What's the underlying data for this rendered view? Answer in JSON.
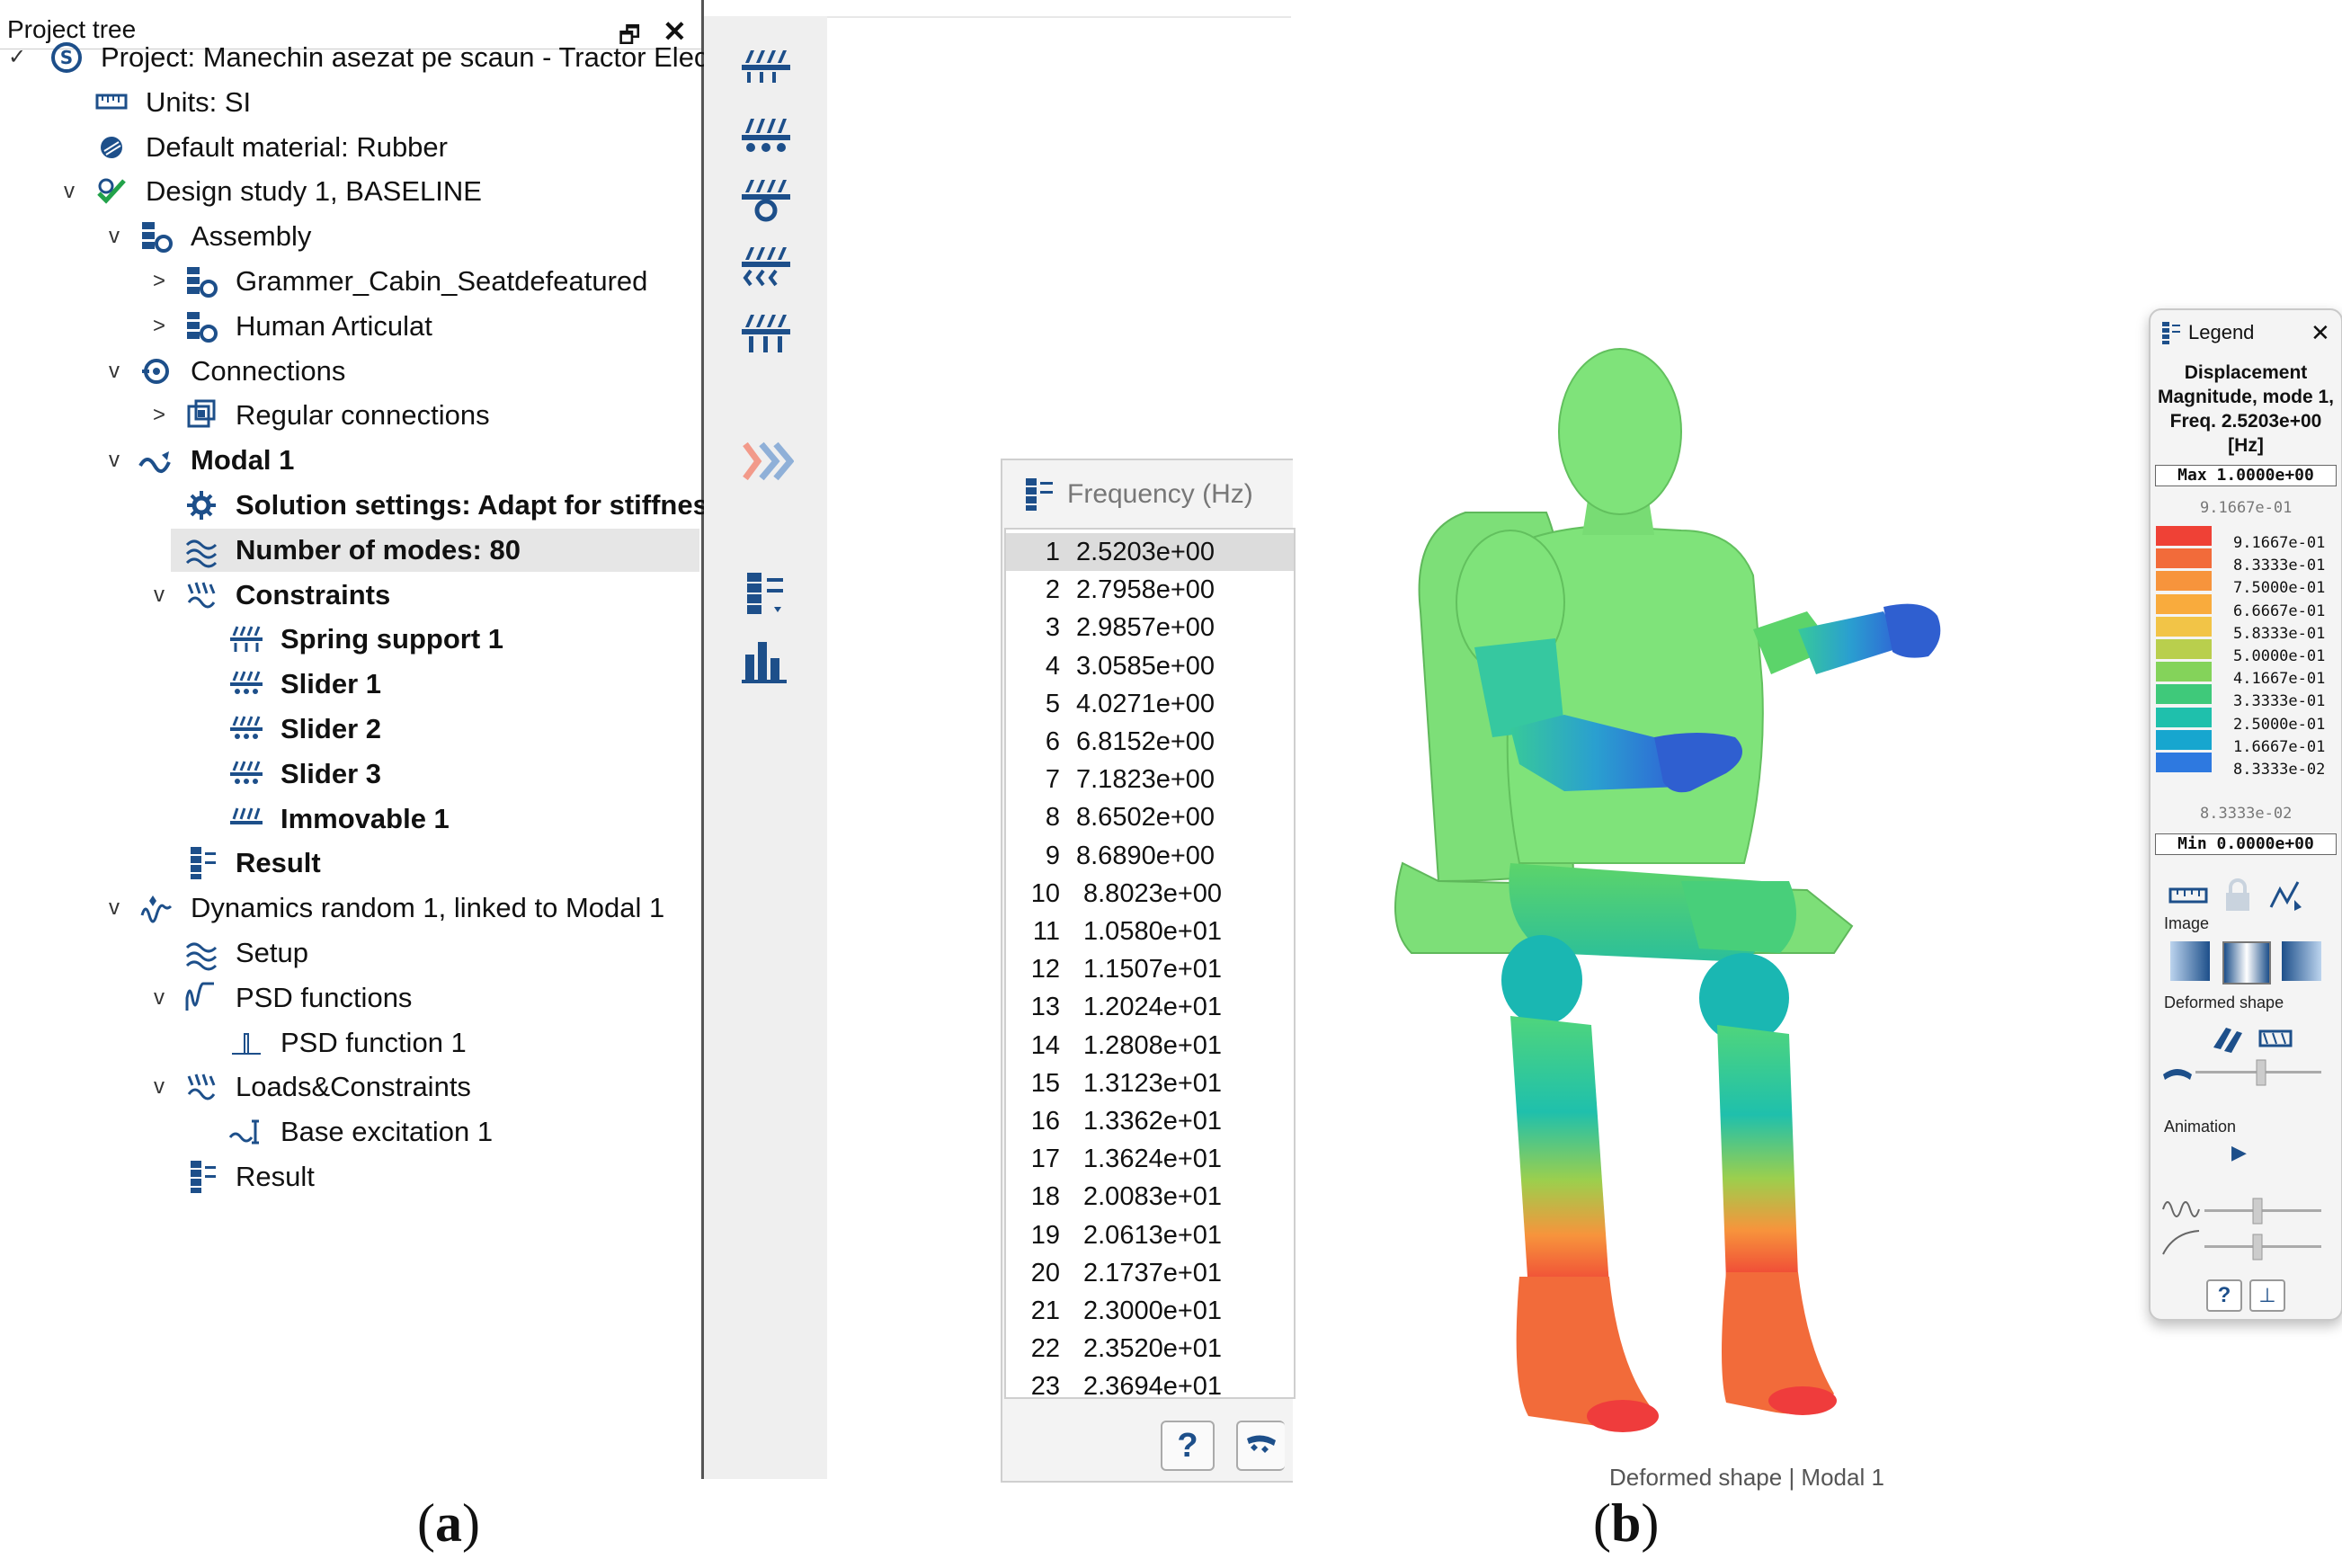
{
  "tree": {
    "title": "Project tree",
    "restore_glyph": "🗗",
    "close_glyph": "✕",
    "items": [
      {
        "label": "Project: Manechin asezat pe scaun - Tractor Elec...",
        "icon": "project-icon",
        "level": 0,
        "chev": "✓"
      },
      {
        "label": "Units: SI",
        "icon": "units-icon",
        "level": 1,
        "chev": ""
      },
      {
        "label": "Default material: Rubber",
        "icon": "material-icon",
        "level": 1,
        "chev": ""
      },
      {
        "label": "Design study 1, BASELINE",
        "icon": "design-study-icon",
        "level": 1,
        "chev": "v"
      },
      {
        "label": "Assembly",
        "icon": "assembly-icon",
        "level": 2,
        "chev": "v"
      },
      {
        "label": "Grammer_Cabin_Seatdefeatured",
        "icon": "assembly-icon",
        "level": 3,
        "chev": ">"
      },
      {
        "label": "Human Articulat",
        "icon": "assembly-icon",
        "level": 3,
        "chev": ">"
      },
      {
        "label": "Connections",
        "icon": "connections-icon",
        "level": 2,
        "chev": "v"
      },
      {
        "label": "Regular connections",
        "icon": "regular-connections-icon",
        "level": 3,
        "chev": ">"
      },
      {
        "label": "Modal 1",
        "icon": "modal-icon",
        "level": 2,
        "chev": "v",
        "bold": true
      },
      {
        "label": "Solution settings: Adapt for stiffness",
        "icon": "gear-icon",
        "level": 3,
        "chev": "",
        "bold": true
      },
      {
        "label": "Number of modes: 80",
        "icon": "modes-icon",
        "level": 3,
        "chev": "",
        "bold": true,
        "selected": true
      },
      {
        "label": "Constraints",
        "icon": "constraints-icon",
        "level": 3,
        "chev": "v",
        "bold": true
      },
      {
        "label": "Spring support 1",
        "icon": "spring-support-icon",
        "level": 4,
        "chev": "",
        "bold": true
      },
      {
        "label": "Slider 1",
        "icon": "slider-icon",
        "level": 4,
        "chev": "",
        "bold": true
      },
      {
        "label": "Slider 2",
        "icon": "slider-icon",
        "level": 4,
        "chev": "",
        "bold": true
      },
      {
        "label": "Slider 3",
        "icon": "slider-icon",
        "level": 4,
        "chev": "",
        "bold": true
      },
      {
        "label": "Immovable 1",
        "icon": "immovable-icon",
        "level": 4,
        "chev": "",
        "bold": true
      },
      {
        "label": "Result",
        "icon": "result-icon",
        "level": 3,
        "chev": "",
        "bold": true
      },
      {
        "label": "Dynamics random 1, linked to Modal 1",
        "icon": "dynamics-random-icon",
        "level": 2,
        "chev": "v"
      },
      {
        "label": "Setup",
        "icon": "modes-icon",
        "level": 3,
        "chev": ""
      },
      {
        "label": "PSD functions",
        "icon": "psd-functions-icon",
        "level": 3,
        "chev": "v"
      },
      {
        "label": "PSD function  1",
        "icon": "psd-function-icon",
        "level": 4,
        "chev": ""
      },
      {
        "label": "Loads&Constraints",
        "icon": "constraints-icon",
        "level": 3,
        "chev": "v"
      },
      {
        "label": "Base excitation 1",
        "icon": "base-excitation-icon",
        "level": 4,
        "chev": ""
      },
      {
        "label": "Result",
        "icon": "result-icon",
        "level": 3,
        "chev": ""
      }
    ]
  },
  "freq": {
    "header": "Frequency (Hz)",
    "rows": [
      {
        "n": "1",
        "v": "2.5203e+00"
      },
      {
        "n": "2",
        "v": "2.7958e+00"
      },
      {
        "n": "3",
        "v": "2.9857e+00"
      },
      {
        "n": "4",
        "v": "3.0585e+00"
      },
      {
        "n": "5",
        "v": "4.0271e+00"
      },
      {
        "n": "6",
        "v": "6.8152e+00"
      },
      {
        "n": "7",
        "v": "7.1823e+00"
      },
      {
        "n": "8",
        "v": "8.6502e+00"
      },
      {
        "n": "9",
        "v": "8.6890e+00"
      },
      {
        "n": "10",
        "v": "8.8023e+00"
      },
      {
        "n": "11",
        "v": "1.0580e+01"
      },
      {
        "n": "12",
        "v": "1.1507e+01"
      },
      {
        "n": "13",
        "v": "1.2024e+01"
      },
      {
        "n": "14",
        "v": "1.2808e+01"
      },
      {
        "n": "15",
        "v": "1.3123e+01"
      },
      {
        "n": "16",
        "v": "1.3362e+01"
      },
      {
        "n": "17",
        "v": "1.3624e+01"
      },
      {
        "n": "18",
        "v": "2.0083e+01"
      },
      {
        "n": "19",
        "v": "2.0613e+01"
      },
      {
        "n": "20",
        "v": "2.1737e+01"
      },
      {
        "n": "21",
        "v": "2.3000e+01"
      },
      {
        "n": "22",
        "v": "2.3520e+01"
      },
      {
        "n": "23",
        "v": "2.3694e+01"
      }
    ],
    "help_label": "?"
  },
  "labels": {
    "a": "a",
    "b": "b",
    "open": "(",
    "close": ")"
  },
  "legend": {
    "header": "Legend",
    "close_glyph": "✕",
    "title": "Displacement Magnitude, mode 1, Freq. 2.5203e+00 [Hz]",
    "max": "Max 1.0000e+00",
    "top_small": "9.1667e-01",
    "values": [
      "9.1667e-01",
      "8.3333e-01",
      "7.5000e-01",
      "6.6667e-01",
      "5.8333e-01",
      "5.0000e-01",
      "4.1667e-01",
      "3.3333e-01",
      "2.5000e-01",
      "1.6667e-01",
      "8.3333e-02"
    ],
    "colors": [
      "#ef4136",
      "#f26b3a",
      "#f7943c",
      "#f9ab3d",
      "#f2c447",
      "#b9cf4d",
      "#84d35a",
      "#3fc97a",
      "#1fc0ac",
      "#17a6cf",
      "#2e79e0"
    ],
    "bottom_small": "8.3333e-02",
    "min": "Min 0.0000e+00",
    "image_label": "Image",
    "deformed_label": "Deformed shape",
    "animation_label": "Animation",
    "help_label": "?"
  },
  "viewport": {
    "caption": "Deformed shape | Modal 1"
  },
  "colors": {
    "body_green": "#7fe37a",
    "blue": "#2f6fd6",
    "red": "#ef3c3c"
  }
}
